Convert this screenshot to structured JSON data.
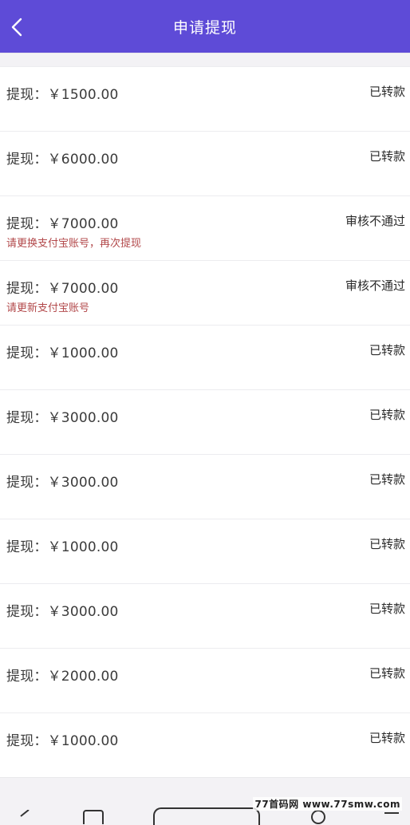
{
  "header": {
    "title": "申请提现",
    "back_icon": "chevron-left-icon",
    "color": "#5e4bd7"
  },
  "records": [
    {
      "amount": "提现：￥1500.00",
      "status": "已转款",
      "note": ""
    },
    {
      "amount": "提现：￥6000.00",
      "status": "已转款",
      "note": ""
    },
    {
      "amount": "提现：￥7000.00",
      "status": "审核不通过",
      "note": "请更换支付宝账号，再次提现"
    },
    {
      "amount": "提现：￥7000.00",
      "status": "审核不通过",
      "note": "请更新支付宝账号"
    },
    {
      "amount": "提现：￥1000.00",
      "status": "已转款",
      "note": ""
    },
    {
      "amount": "提现：￥3000.00",
      "status": "已转款",
      "note": ""
    },
    {
      "amount": "提现：￥3000.00",
      "status": "已转款",
      "note": ""
    },
    {
      "amount": "提现：￥1000.00",
      "status": "已转款",
      "note": ""
    },
    {
      "amount": "提现：￥3000.00",
      "status": "已转款",
      "note": ""
    },
    {
      "amount": "提现：￥2000.00",
      "status": "已转款",
      "note": ""
    },
    {
      "amount": "提现：￥1000.00",
      "status": "已转款",
      "note": ""
    }
  ],
  "watermark": {
    "text": "77首码网 www.77smw.com"
  },
  "colors": {
    "rejected_note": "#b2484a"
  }
}
